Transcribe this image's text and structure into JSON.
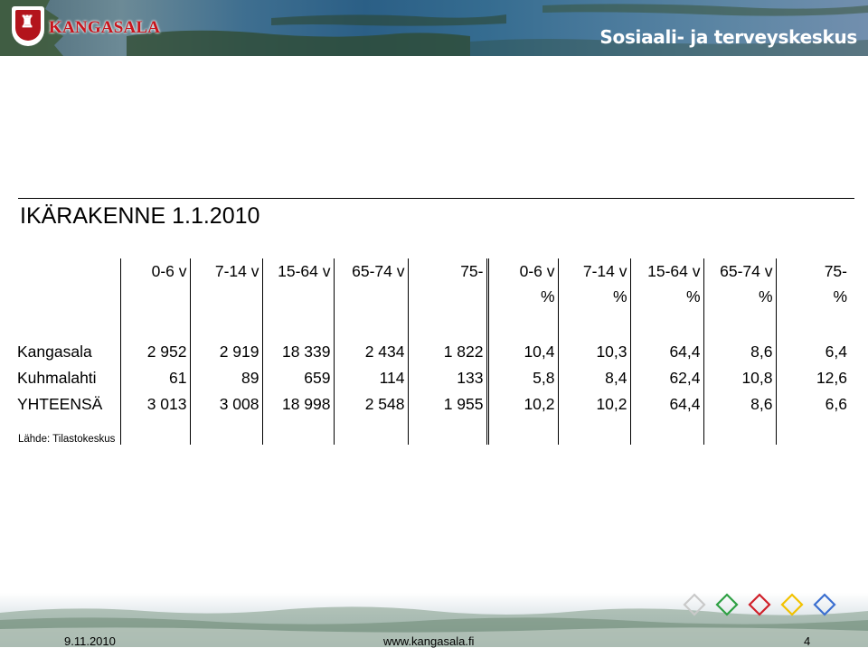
{
  "header": {
    "logo_text": "KANGASALA",
    "section_title": "Sosiaali- ja terveyskeskus"
  },
  "slide": {
    "title": "IKÄRAKENNE 1.1.2010"
  },
  "table": {
    "columns": [
      {
        "line1": "0-6 v",
        "line2": ""
      },
      {
        "line1": "7-14 v",
        "line2": ""
      },
      {
        "line1": "15-64 v",
        "line2": ""
      },
      {
        "line1": "65-74 v",
        "line2": ""
      },
      {
        "line1": "75-",
        "line2": ""
      },
      {
        "line1": "0-6 v",
        "line2": "%"
      },
      {
        "line1": "7-14 v",
        "line2": "%"
      },
      {
        "line1": "15-64 v",
        "line2": "%"
      },
      {
        "line1": "65-74 v",
        "line2": "%"
      },
      {
        "line1": "75-",
        "line2": "%"
      }
    ],
    "rows": [
      {
        "label": "Kangasala",
        "values": [
          "2 952",
          "2 919",
          "18 339",
          "2 434",
          "1 822",
          "10,4",
          "10,3",
          "64,4",
          "8,6",
          "6,4"
        ]
      },
      {
        "label": "Kuhmalahti",
        "values": [
          "61",
          "89",
          "659",
          "114",
          "133",
          "5,8",
          "8,4",
          "62,4",
          "10,8",
          "12,6"
        ]
      },
      {
        "label": "YHTEENSÄ",
        "values": [
          "3 013",
          "3 008",
          "18 998",
          "2 548",
          "1 955",
          "10,2",
          "10,2",
          "64,4",
          "8,6",
          "6,6"
        ]
      }
    ]
  },
  "source": "Lähde: Tilastokeskus",
  "footer": {
    "date": "9.11.2010",
    "url": "www.kangasala.fi",
    "page": "4"
  },
  "diamond_colors": [
    "#c9c9c9",
    "#2ea043",
    "#d0202a",
    "#f2c200",
    "#3b6fd0"
  ]
}
